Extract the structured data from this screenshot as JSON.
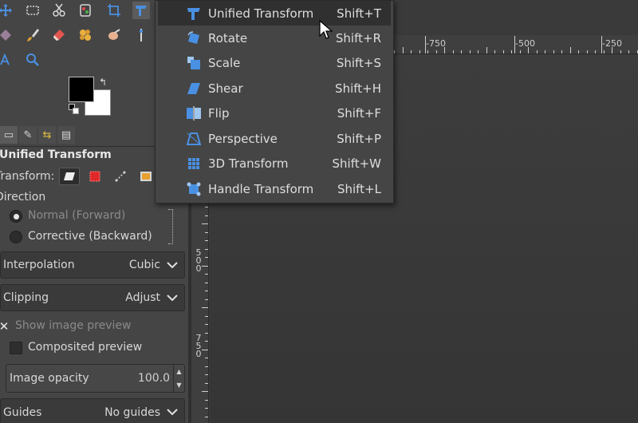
{
  "toolbox": {
    "tools_row1": [
      "move-icon",
      "rect-select-icon",
      "scissors-icon",
      "fuzzy-select-icon",
      "crop-icon",
      "unified-transform-icon"
    ],
    "tools_row2": [
      "warp-icon",
      "paintbrush-icon",
      "eraser-icon",
      "heal-icon",
      "smudge-icon",
      "dodge-icon"
    ],
    "tools_row3": [
      "text-icon",
      "zoom-icon"
    ],
    "fg_color": "#000000",
    "bg_color": "#ffffff"
  },
  "tool_options": {
    "title": "Unified Transform",
    "transform_label": "Transform:",
    "direction_label": "Direction",
    "direction_options": [
      "Normal (Forward)",
      "Corrective (Backward)"
    ],
    "interpolation": {
      "label": "Interpolation",
      "value": "Cubic"
    },
    "clipping": {
      "label": "Clipping",
      "value": "Adjust"
    },
    "show_preview_label": "Show image preview",
    "composited_preview_label": "Composited preview",
    "image_opacity": {
      "label": "Image opacity",
      "value": "100.0"
    },
    "guides": {
      "label": "Guides",
      "value": "No guides"
    }
  },
  "rulers": {
    "horizontal_labels": [
      "-750",
      "-500",
      "-250"
    ],
    "vertical_labels": [
      "500",
      "750"
    ]
  },
  "menu": {
    "items": [
      {
        "label": "Unified Transform",
        "shortcut": "Shift+T",
        "icon": "unified-transform-icon"
      },
      {
        "label": "Rotate",
        "shortcut": "Shift+R",
        "icon": "rotate-icon"
      },
      {
        "label": "Scale",
        "shortcut": "Shift+S",
        "icon": "scale-icon"
      },
      {
        "label": "Shear",
        "shortcut": "Shift+H",
        "icon": "shear-icon"
      },
      {
        "label": "Flip",
        "shortcut": "Shift+F",
        "icon": "flip-icon"
      },
      {
        "label": "Perspective",
        "shortcut": "Shift+P",
        "icon": "perspective-icon"
      },
      {
        "label": "3D Transform",
        "shortcut": "Shift+W",
        "icon": "3d-transform-icon"
      },
      {
        "label": "Handle Transform",
        "shortcut": "Shift+L",
        "icon": "handle-transform-icon"
      }
    ]
  },
  "colors": {
    "accent_blue": "#4a90e2",
    "menu_highlight": "#303030"
  }
}
